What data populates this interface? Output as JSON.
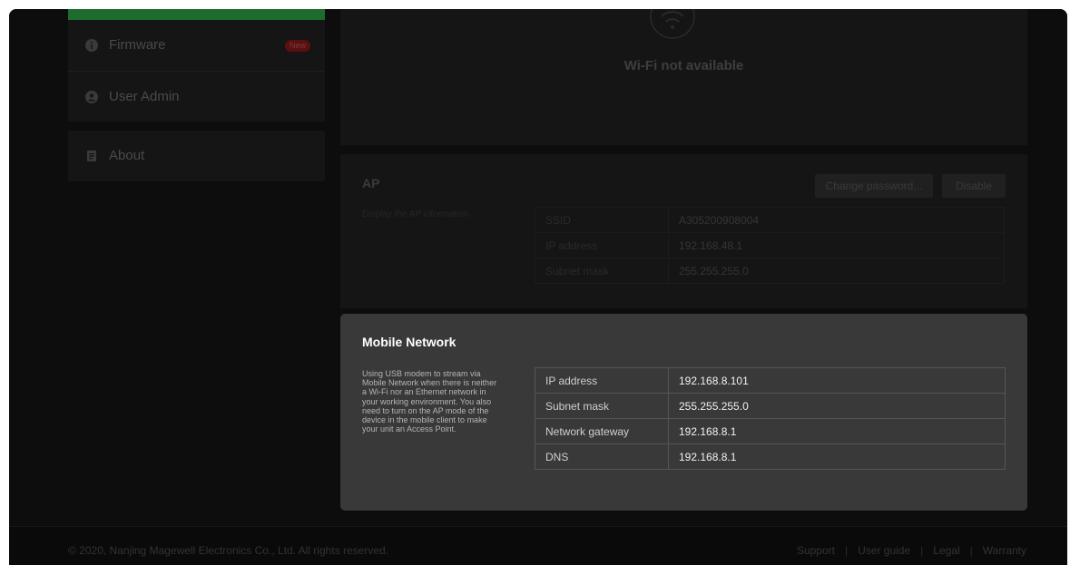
{
  "sidebar": {
    "items": [
      {
        "label": "Firmware",
        "icon": "info-icon",
        "badge": "New"
      },
      {
        "label": "User Admin",
        "icon": "user-icon"
      },
      {
        "label": "About",
        "icon": "document-icon"
      }
    ]
  },
  "wifi": {
    "status": "Wi-Fi not available"
  },
  "ap": {
    "title": "AP",
    "description": "Display the AP information",
    "buttons": {
      "change_password": "Change password...",
      "disable": "Disable"
    },
    "rows": [
      {
        "key": "SSID",
        "value": "A305200908004"
      },
      {
        "key": "IP address",
        "value": "192.168.48.1"
      },
      {
        "key": "Subnet mask",
        "value": "255.255.255.0"
      }
    ]
  },
  "mobile": {
    "title": "Mobile Network",
    "description": "Using USB modem to stream via Mobile Network when there is neither a Wi-Fi nor an Ethernet network in your working environment. You also need to turn on the AP mode of the device in the mobile client to make your unit an Access Point.",
    "rows": [
      {
        "key": "IP address",
        "value": "192.168.8.101"
      },
      {
        "key": "Subnet mask",
        "value": "255.255.255.0"
      },
      {
        "key": "Network gateway",
        "value": "192.168.8.1"
      },
      {
        "key": "DNS",
        "value": "192.168.8.1"
      }
    ]
  },
  "footer": {
    "copyright": "© 2020, Nanjing Magewell Electronics Co., Ltd. All rights reserved.",
    "links": [
      "Support",
      "User guide",
      "Legal",
      "Warranty"
    ],
    "separator": "|"
  }
}
